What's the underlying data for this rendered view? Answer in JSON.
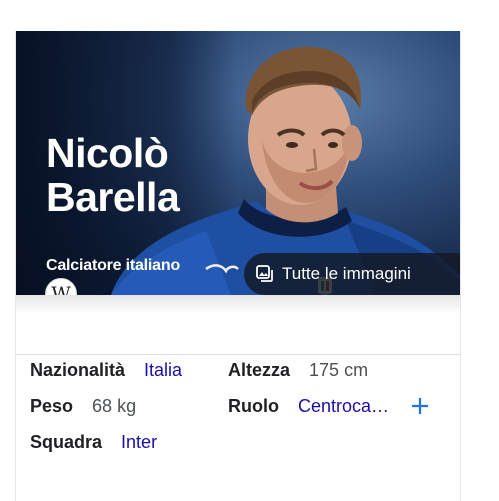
{
  "hero": {
    "name_line1": "Nicolò",
    "name_line2": "Barella",
    "subtitle": "Calciatore italiano",
    "all_images_label": "Tutte le immagini"
  },
  "facts": {
    "nationality_label": "Nazionalità",
    "nationality_value": "Italia",
    "height_label": "Altezza",
    "height_value": "175 cm",
    "weight_label": "Peso",
    "weight_value": "68 kg",
    "role_label": "Ruolo",
    "role_value": "Centroca…",
    "team_label": "Squadra",
    "team_value": "Inter"
  },
  "icons": {
    "wiki": "wikipedia-icon",
    "images": "image-gallery-icon",
    "expand": "plus-icon"
  },
  "colors": {
    "link": "#1a0dab",
    "accent": "#1a73e8",
    "text": "#202124"
  }
}
